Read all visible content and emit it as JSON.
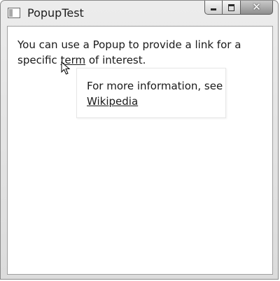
{
  "window": {
    "title": "PopupTest",
    "close_glyph": "✕"
  },
  "content": {
    "text_before": "You can use a Popup to provide a link for a specific ",
    "term_link": "term",
    "text_after": " of interest."
  },
  "popup": {
    "text": "For more information, see",
    "link": "Wikipedia"
  },
  "icons": {
    "app": "window-app-icon",
    "minimize": "minimize-icon",
    "maximize": "maximize-icon",
    "close": "close-icon",
    "cursor": "mouse-pointer-icon"
  }
}
